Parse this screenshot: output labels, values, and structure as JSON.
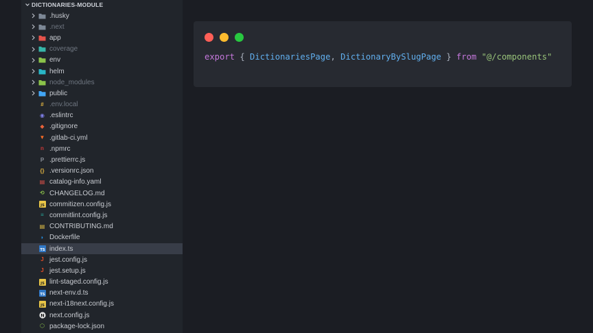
{
  "explorer": {
    "title": "DICTIONARIES-MODULE",
    "items": [
      {
        "label": ".husky",
        "type": "folder",
        "icon": "husky-folder-icon",
        "color": "#7d8896",
        "dim": false
      },
      {
        "label": ".next",
        "type": "folder",
        "icon": "next-folder-icon",
        "color": "#7d8896",
        "dim": true
      },
      {
        "label": "app",
        "type": "folder",
        "icon": "app-folder-icon",
        "color": "#e5534b",
        "dim": false
      },
      {
        "label": "coverage",
        "type": "folder",
        "icon": "coverage-folder-icon",
        "color": "#36b5a8",
        "dim": true
      },
      {
        "label": "env",
        "type": "folder",
        "icon": "env-folder-icon",
        "color": "#8bc34a",
        "dim": false
      },
      {
        "label": "helm",
        "type": "folder",
        "icon": "helm-folder-icon",
        "color": "#29b6c6",
        "dim": false
      },
      {
        "label": "node_modules",
        "type": "folder",
        "icon": "node-modules-folder-icon",
        "color": "#8bc34a",
        "dim": true
      },
      {
        "label": "public",
        "type": "folder",
        "icon": "public-folder-icon",
        "color": "#42a5f5",
        "dim": false
      },
      {
        "label": ".env.local",
        "type": "file",
        "icon": "env-file-icon",
        "color": "#e0b341",
        "dim": true
      },
      {
        "label": ".eslintrc",
        "type": "file",
        "icon": "eslint-icon",
        "color": "#7e7ee6",
        "dim": false
      },
      {
        "label": ".gitignore",
        "type": "file",
        "icon": "git-icon",
        "color": "#e8623a",
        "dim": false
      },
      {
        "label": ".gitlab-ci.yml",
        "type": "file",
        "icon": "gitlab-icon",
        "color": "#fc6d26",
        "dim": false
      },
      {
        "label": ".npmrc",
        "type": "file",
        "icon": "npm-icon",
        "color": "#cb3837",
        "dim": false
      },
      {
        "label": ".prettierrc.js",
        "type": "file",
        "icon": "prettier-icon",
        "color": "#8a8f98",
        "dim": false
      },
      {
        "label": ".versionrc.json",
        "type": "file",
        "icon": "json-braces-icon",
        "color": "#e0b341",
        "dim": false
      },
      {
        "label": "catalog-info.yaml",
        "type": "file",
        "icon": "yaml-icon",
        "color": "#e5534b",
        "dim": false
      },
      {
        "label": "CHANGELOG.md",
        "type": "file",
        "icon": "changelog-icon",
        "color": "#8bc34a",
        "dim": false
      },
      {
        "label": "commitizen.config.js",
        "type": "file",
        "icon": "js-file-icon",
        "color": "#e8c547",
        "dim": false
      },
      {
        "label": "commitlint.config.js",
        "type": "file",
        "icon": "commitlint-icon",
        "color": "#26a69a",
        "dim": false
      },
      {
        "label": "CONTRIBUTING.md",
        "type": "file",
        "icon": "contributing-icon",
        "color": "#e8c547",
        "dim": false
      },
      {
        "label": "Dockerfile",
        "type": "file",
        "icon": "docker-icon",
        "color": "#2496ed",
        "dim": false
      },
      {
        "label": "index.ts",
        "type": "file",
        "icon": "ts-file-icon",
        "color": "#3178c6",
        "dim": false,
        "selected": true
      },
      {
        "label": "jest.config.js",
        "type": "file",
        "icon": "jest-icon",
        "color": "#e44d26",
        "dim": false
      },
      {
        "label": "jest.setup.js",
        "type": "file",
        "icon": "jest-icon",
        "color": "#e44d26",
        "dim": false
      },
      {
        "label": "lint-staged.config.js",
        "type": "file",
        "icon": "js-file-icon",
        "color": "#e8c547",
        "dim": false
      },
      {
        "label": "next-env.d.ts",
        "type": "file",
        "icon": "ts-def-icon",
        "color": "#3178c6",
        "dim": false
      },
      {
        "label": "next-i18next.config.js",
        "type": "file",
        "icon": "js-file-icon",
        "color": "#e8c547",
        "dim": false
      },
      {
        "label": "next.config.js",
        "type": "file",
        "icon": "nextjs-icon",
        "color": "#e6e6e6",
        "dim": false
      },
      {
        "label": "package-lock.json",
        "type": "file",
        "icon": "npm-lock-icon",
        "color": "#8bc34a",
        "dim": false
      }
    ]
  },
  "code": {
    "tokens": [
      {
        "text": "export",
        "color": "#c678dd"
      },
      {
        "text": " { ",
        "color": "#abb2bf"
      },
      {
        "text": "DictionariesPage",
        "color": "#61afef"
      },
      {
        "text": ", ",
        "color": "#abb2bf"
      },
      {
        "text": "DictionaryBySlugPage",
        "color": "#61afef"
      },
      {
        "text": " } ",
        "color": "#abb2bf"
      },
      {
        "text": "from",
        "color": "#c678dd"
      },
      {
        "text": " ",
        "color": "#abb2bf"
      },
      {
        "text": "\"@/components\"",
        "color": "#98c379"
      }
    ],
    "window_dots": [
      "#ff5f57",
      "#febc2e",
      "#28c840"
    ]
  }
}
